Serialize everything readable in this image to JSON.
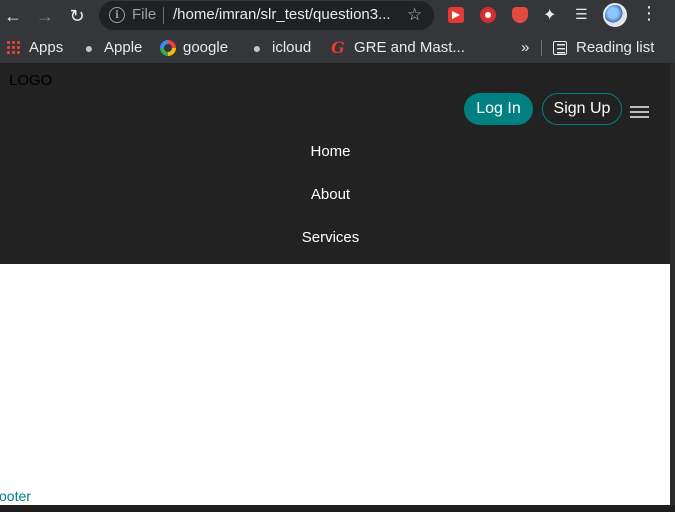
{
  "browser": {
    "omnibox": {
      "scheme_label": "File",
      "url": "/home/imran/slr_test/question3..."
    },
    "bookmarks": [
      {
        "label": "Apps",
        "icon": "apps-grid-icon"
      },
      {
        "label": "Apple",
        "icon": "apple-icon"
      },
      {
        "label": "google",
        "icon": "google-icon"
      },
      {
        "label": "icloud",
        "icon": "apple-icon"
      },
      {
        "label": "GRE and Mast...",
        "icon": "gre-icon"
      }
    ],
    "more_bookmarks": "»",
    "reading_list": "Reading list"
  },
  "page": {
    "logo": "LOGO",
    "login_label": "Log In",
    "signup_label": "Sign Up",
    "nav": [
      "Home",
      "About",
      "Services"
    ],
    "footer": "ooter",
    "colors": {
      "header_bg": "#222222",
      "accent": "#008080",
      "page_bg": "#ffffff"
    }
  }
}
